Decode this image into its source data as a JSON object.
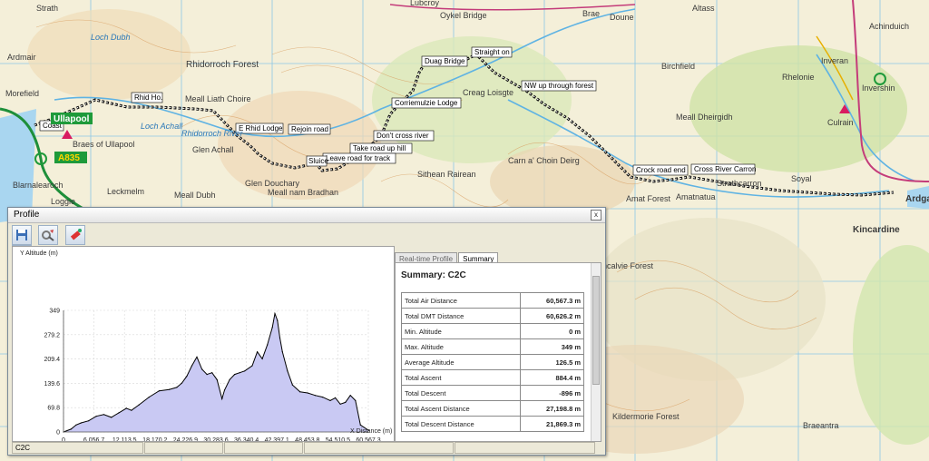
{
  "map": {
    "route_labels": [
      "Coast",
      "Rhid Ho.",
      "E Rhid Lodge",
      "Rejoin road",
      "Don't cross river",
      "Take road up hill",
      "Leave road for track",
      "Sluice",
      "Corriemulzie Lodge",
      "Duag Bridge",
      "Straight on",
      "NW up through forest",
      "Crock road end",
      "Cross River Carron"
    ],
    "place_labels": [
      "Ullapool",
      "A835",
      "Strath",
      "Ardmair",
      "Loch Dubh",
      "Morefield",
      "Rhidorroch Forest",
      "Braes of Ullapool",
      "Loch Achall",
      "Rhidorroch River",
      "Glen Achall",
      "Leckmelm",
      "Loggie",
      "Blarnalearoch",
      "Glen Douchary",
      "Meall nam Bradhan",
      "Meall Dubh",
      "Lubcroy",
      "Oykel Bridge",
      "Doune",
      "Brae",
      "Birchfield",
      "Altass",
      "Achinduich",
      "Inveran",
      "Rhelonie",
      "Invershin",
      "Culrain",
      "Soyal",
      "Kincardine",
      "Ardgay",
      "Amatnatua",
      "Strathcarron",
      "Amat Forest",
      "Glencalvie Forest",
      "Kildermorie Forest",
      "Braeantra",
      "Meall Liath Choire",
      "Meall Dheirgidh",
      "Creag Loisgte",
      "Carn a' Choin Deirg",
      "Sithean Rairean"
    ]
  },
  "profile_window": {
    "title": "Profile",
    "close_label": "x",
    "chart": {
      "ylabel": "Y Altitude (m)",
      "xlabel": "X Distance (m)"
    },
    "tabs": [
      "Real-time Profile",
      "Summary"
    ],
    "active_tab": "Summary",
    "summary": {
      "title": "Summary: C2C",
      "rows": [
        {
          "label": "Total Air Distance",
          "value": "60,567.3 m"
        },
        {
          "label": "Total DMT Distance",
          "value": "60,626.2 m"
        },
        {
          "label": "Min. Altitude",
          "value": "0 m"
        },
        {
          "label": "Max. Altitude",
          "value": "349 m"
        },
        {
          "label": "Average Altitude",
          "value": "126.5 m"
        },
        {
          "label": "Total Ascent",
          "value": "884.4 m"
        },
        {
          "label": "Total Descent",
          "value": "-896 m"
        },
        {
          "label": "Total Ascent Distance",
          "value": "27,198.8 m"
        },
        {
          "label": "Total Descent Distance",
          "value": "21,869.3 m"
        }
      ]
    },
    "status": {
      "name": "C2C",
      "cells": [
        "",
        "",
        "",
        ""
      ]
    }
  },
  "chart_data": {
    "type": "area",
    "title": "",
    "xlabel": "X Distance (m)",
    "ylabel": "Y Altitude (m)",
    "xlim": [
      0,
      60567.3
    ],
    "ylim": [
      0,
      349
    ],
    "xticks": [
      "0",
      "6,056.7",
      "12,113.5",
      "18,170.2",
      "24,226.9",
      "30,283.6",
      "36,340.4",
      "42,397.1",
      "48,453.8",
      "54,510.5",
      "60,567.3"
    ],
    "yticks": [
      "0",
      "69.8",
      "139.6",
      "209.4",
      "279.2",
      "349"
    ],
    "x": [
      0,
      1500,
      2500,
      3500,
      5000,
      6500,
      8000,
      9500,
      11000,
      12500,
      13500,
      15000,
      17000,
      19000,
      21000,
      22500,
      23500,
      24500,
      25500,
      26500,
      27500,
      28500,
      29500,
      30500,
      31500,
      32000,
      33000,
      34000,
      35000,
      36000,
      37500,
      38500,
      39500,
      40500,
      41500,
      42000,
      42500,
      43000,
      43500,
      44500,
      45500,
      47000,
      48500,
      50000,
      51500,
      53000,
      54000,
      55000,
      56000,
      57000,
      58000,
      59000,
      60567.3
    ],
    "y": [
      0,
      8,
      20,
      26,
      32,
      45,
      50,
      42,
      55,
      68,
      62,
      78,
      100,
      118,
      122,
      128,
      140,
      160,
      190,
      215,
      180,
      165,
      170,
      150,
      95,
      120,
      150,
      165,
      170,
      175,
      190,
      230,
      210,
      250,
      300,
      340,
      320,
      270,
      230,
      175,
      135,
      115,
      112,
      105,
      100,
      90,
      98,
      80,
      85,
      105,
      90,
      20,
      5
    ],
    "grid": true,
    "legend": "none",
    "fill_color": "#c9c9f3",
    "line_color": "#000000"
  }
}
